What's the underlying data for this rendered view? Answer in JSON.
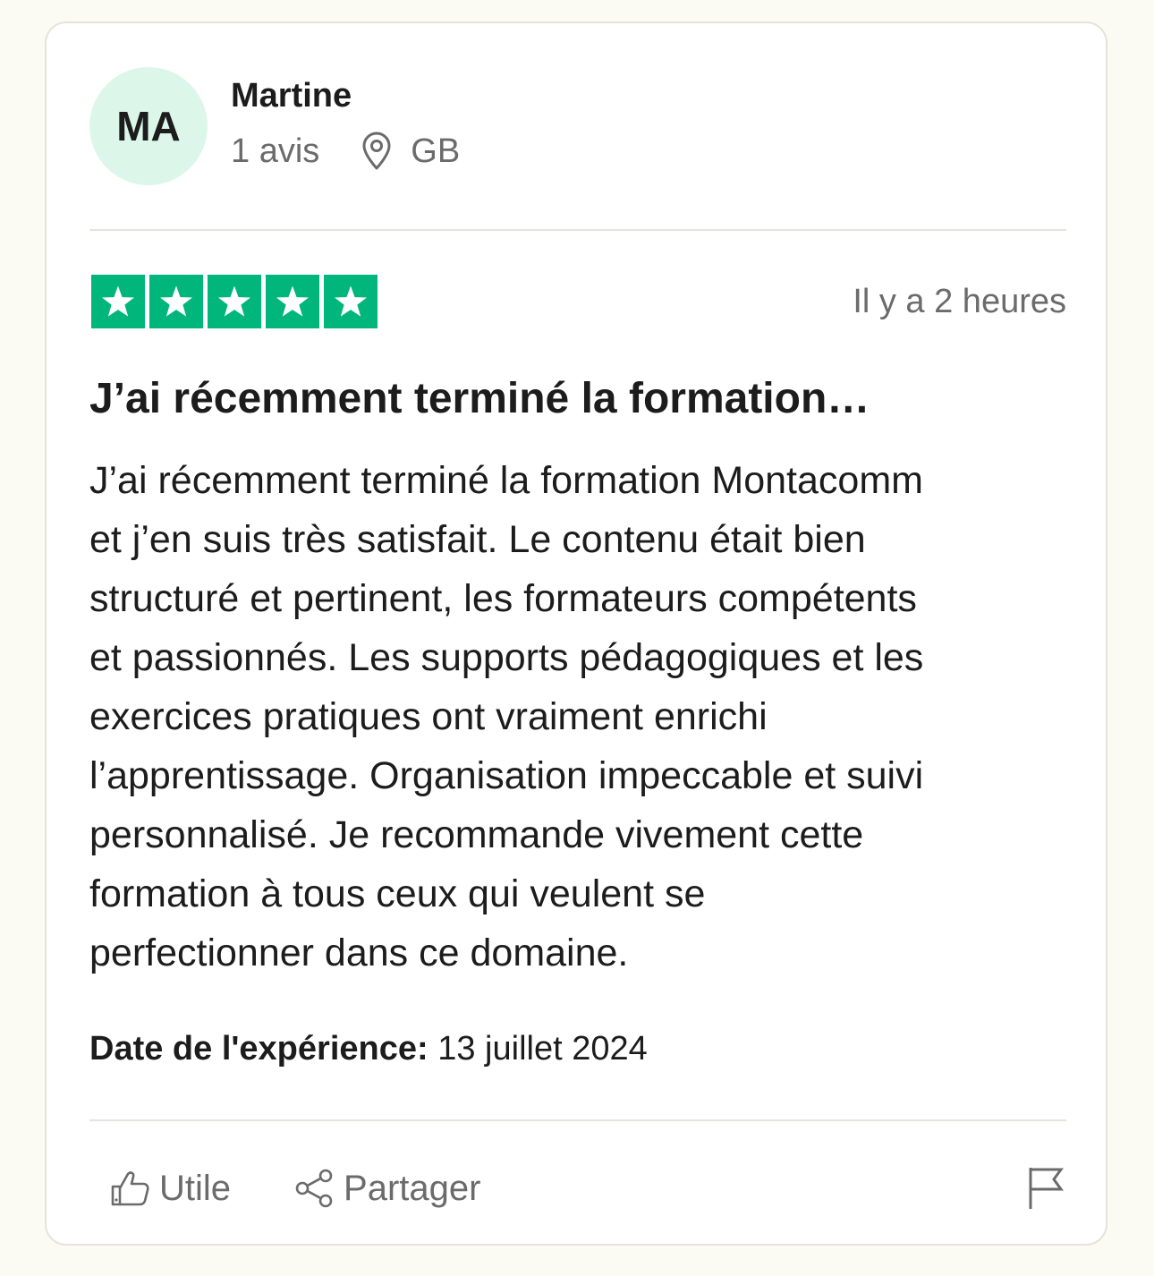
{
  "reviewer": {
    "initials": "MA",
    "name": "Martine",
    "review_count": "1 avis",
    "country": "GB"
  },
  "rating": {
    "stars": 5,
    "max": 5,
    "color": "#00b67a"
  },
  "time_ago": "Il y a 2 heures",
  "review": {
    "title": "J’ai récemment terminé la formation…",
    "body_lines": [
      "J’ai récemment terminé la formation Montacomm",
      "et j’en suis très satisfait. Le contenu était bien",
      "structuré et pertinent, les formateurs compétents",
      "et passionnés. Les supports pédagogiques et les",
      "exercices pratiques ont vraiment enrichi",
      "l’apprentissage. Organisation impeccable et suivi",
      "personnalisé. Je recommande vivement cette",
      "formation à tous ceux qui veulent se",
      "perfectionner dans ce domaine."
    ]
  },
  "experience": {
    "label": "Date de l'expérience:",
    "date": "13 juillet 2024"
  },
  "actions": {
    "useful_label": "Utile",
    "share_label": "Partager"
  },
  "colors": {
    "avatar_bg": "#dcf7ea",
    "page_bg": "#fbfaf3",
    "muted_text": "#6b6b6b"
  }
}
